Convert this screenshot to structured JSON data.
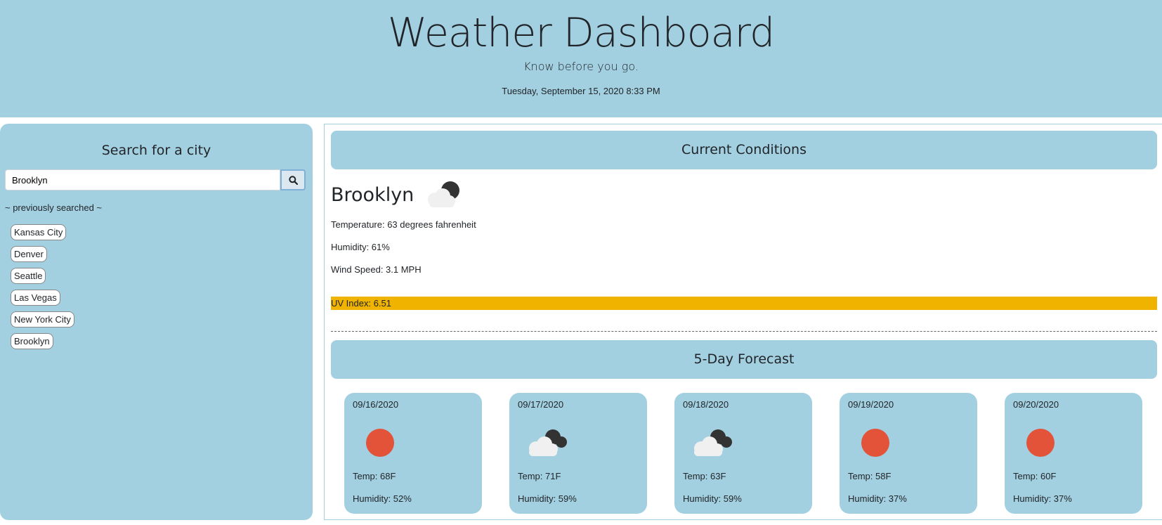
{
  "header": {
    "title": "Weather Dashboard",
    "tagline": "Know before you go.",
    "datetime": "Tuesday, September 15, 2020 8:33 PM"
  },
  "sidebar": {
    "heading": "Search for a city",
    "search_value": "Brooklyn",
    "search_icon": "search-icon",
    "previously_label": "~ previously searched ~",
    "history": [
      "Kansas City",
      "Denver",
      "Seattle",
      "Las Vegas",
      "New York City",
      "Brooklyn"
    ]
  },
  "current": {
    "heading": "Current Conditions",
    "city": "Brooklyn",
    "icon": "partly-cloudy-night-icon",
    "temperature": "Temperature: 63 degrees fahrenheit",
    "humidity": "Humidity: 61%",
    "wind": "Wind Speed: 3.1 MPH",
    "uv": "UV Index: 6.51",
    "uv_color": "#f0b400"
  },
  "forecast": {
    "heading": "5-Day Forecast",
    "days": [
      {
        "date": "09/16/2020",
        "icon": "sun-icon",
        "temp": "Temp: 68F",
        "humidity": "Humidity: 52%"
      },
      {
        "date": "09/17/2020",
        "icon": "cloudy-night-icon",
        "temp": "Temp: 71F",
        "humidity": "Humidity: 59%"
      },
      {
        "date": "09/18/2020",
        "icon": "cloudy-night-icon",
        "temp": "Temp: 63F",
        "humidity": "Humidity: 59%"
      },
      {
        "date": "09/19/2020",
        "icon": "sun-icon",
        "temp": "Temp: 58F",
        "humidity": "Humidity: 37%"
      },
      {
        "date": "09/20/2020",
        "icon": "sun-icon",
        "temp": "Temp: 60F",
        "humidity": "Humidity: 37%"
      }
    ]
  },
  "colors": {
    "panel": "#a3d0e0",
    "sun": "#e2533a"
  }
}
